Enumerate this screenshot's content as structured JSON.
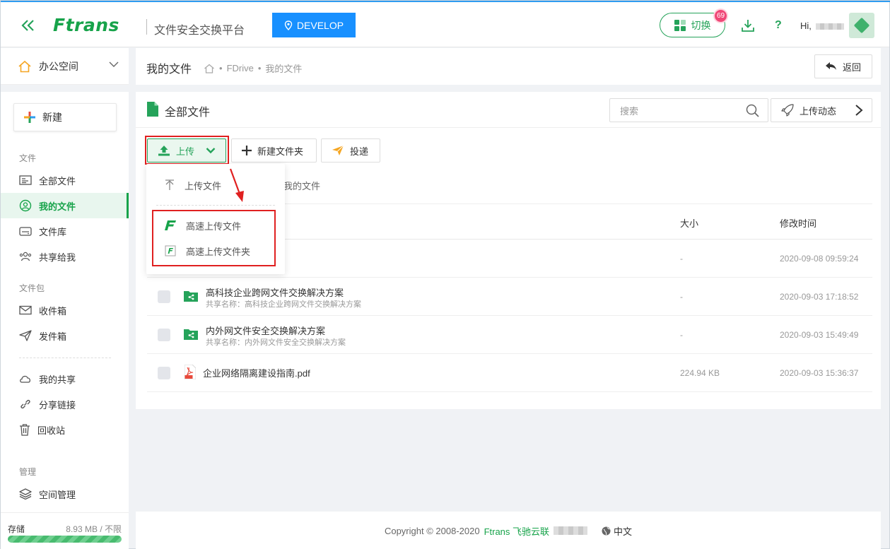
{
  "header": {
    "logo": "Ftrans",
    "platform": "文件安全交换平台",
    "env": "DEVELOP",
    "switch_label": "切换",
    "badge": "69",
    "help": "?",
    "greeting": "Hi,"
  },
  "sidebar": {
    "workspace": "办公空间",
    "new_label": "新建",
    "section_files": "文件",
    "section_pack": "文件包",
    "section_manage": "管理",
    "items": {
      "all_files": "全部文件",
      "my_files": "我的文件",
      "file_library": "文件库",
      "shared_to_me": "共享给我",
      "inbox": "收件箱",
      "outbox": "发件箱",
      "my_shares": "我的共享",
      "share_links": "分享链接",
      "recycle": "回收站",
      "space_mgmt": "空间管理"
    },
    "storage_label": "存储",
    "storage_value": "8.93 MB / 不限"
  },
  "topbar": {
    "title": "我的文件",
    "crumbs": [
      "FDrive",
      "我的文件"
    ],
    "back_label": "返回"
  },
  "main": {
    "title": "全部文件",
    "search_placeholder": "搜索",
    "upload_dynamics": "上传动态",
    "toolbar": {
      "upload": "上传",
      "new_folder": "新建文件夹",
      "deliver": "投递"
    },
    "path_tail": "我的文件",
    "columns": {
      "size": "大小",
      "time": "修改时间"
    },
    "rows": [
      {
        "name": "",
        "sub": "",
        "size": "-",
        "time": "2020-09-08 09:59:24"
      },
      {
        "name": "高科技企业跨网文件交换解决方案",
        "sub": "共享名称：高科技企业跨网文件交换解决方案",
        "size": "-",
        "time": "2020-09-03 17:18:52"
      },
      {
        "name": "内外网文件安全交换解决方案",
        "sub": "共享名称：内外网文件安全交换解决方案",
        "size": "-",
        "time": "2020-09-03 15:49:49"
      },
      {
        "name": "企业网络隔离建设指南.pdf",
        "sub": "",
        "size": "224.94 KB",
        "time": "2020-09-03 15:36:37"
      }
    ],
    "dropdown": {
      "upload_file": "上传文件",
      "fast_upload_file": "高速上传文件",
      "fast_upload_folder": "高速上传文件夹"
    }
  },
  "footer": {
    "copyright": "Copyright © 2008-2020",
    "brand": "Ftrans 飞驰云联",
    "lang": "中文"
  },
  "colors": {
    "accent": "#17a34a",
    "primary": "#1890ff",
    "badge": "#f04877",
    "highlight": "#e02020"
  }
}
